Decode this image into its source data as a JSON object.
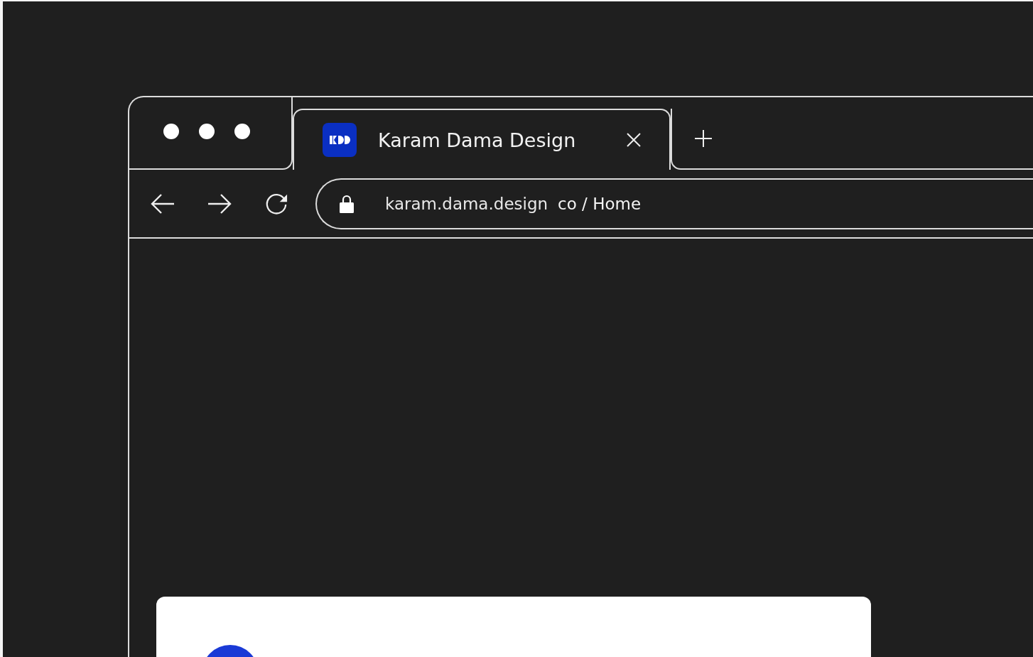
{
  "tabs": [
    {
      "title": "Karam Dama Design",
      "selected": true
    }
  ],
  "address_bar": {
    "host": "karam.dama.design",
    "path": "co / Home"
  }
}
